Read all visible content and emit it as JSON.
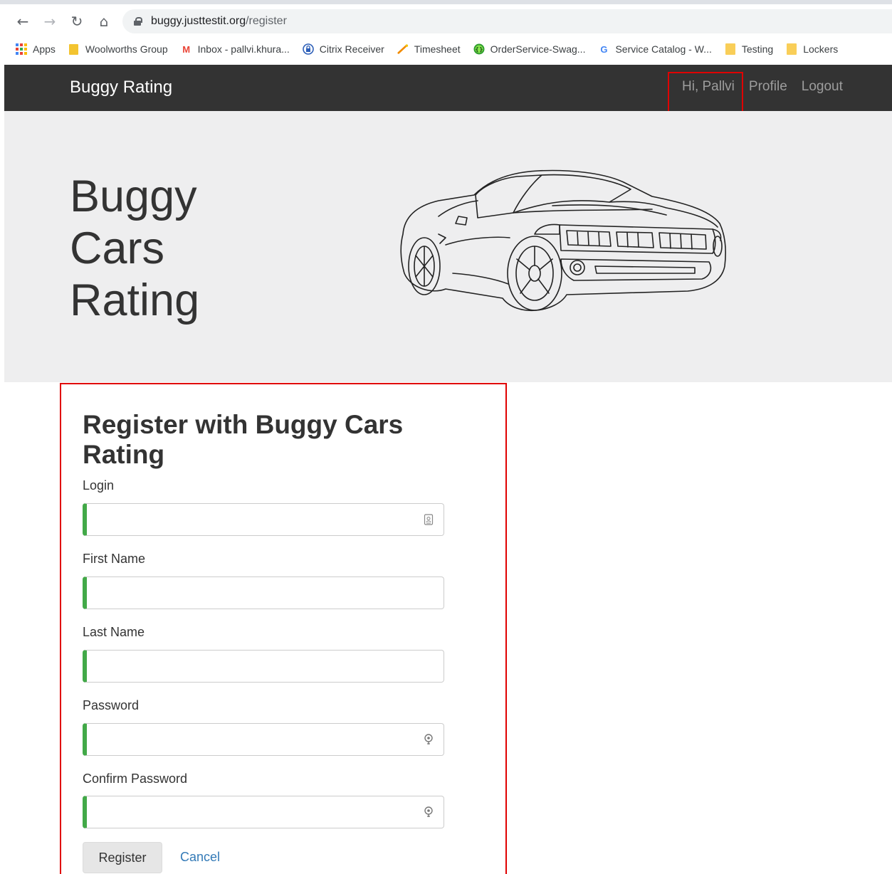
{
  "browser": {
    "url_host": "buggy.justtestit.org",
    "url_path": "/register",
    "bookmarks": [
      {
        "label": "Apps",
        "icon": "apps-grid-icon"
      },
      {
        "label": "Woolworths Group",
        "icon": "woolworths-icon"
      },
      {
        "label": "Inbox - pallvi.khura...",
        "icon": "gmail-icon"
      },
      {
        "label": "Citrix Receiver",
        "icon": "citrix-icon"
      },
      {
        "label": "Timesheet",
        "icon": "timesheet-icon"
      },
      {
        "label": "OrderService-Swag...",
        "icon": "swagger-icon"
      },
      {
        "label": "Service Catalog - W...",
        "icon": "google-icon"
      },
      {
        "label": "Testing",
        "icon": "folder-icon"
      },
      {
        "label": "Lockers",
        "icon": "folder-icon"
      }
    ]
  },
  "navbar": {
    "brand": "Buggy Rating",
    "greeting": "Hi, Pallvi",
    "profile": "Profile",
    "logout": "Logout",
    "bg_color": "#333333"
  },
  "hero": {
    "line1": "Buggy",
    "line2": "Cars",
    "line3": "Rating"
  },
  "form": {
    "title": "Register with Buggy Cars Rating",
    "fields": [
      {
        "label": "Login",
        "value": "",
        "icon": "contact-card-icon"
      },
      {
        "label": "First Name",
        "value": "",
        "icon": ""
      },
      {
        "label": "Last Name",
        "value": "",
        "icon": ""
      },
      {
        "label": "Password",
        "value": "",
        "icon": "password-key-icon"
      },
      {
        "label": "Confirm Password",
        "value": "",
        "icon": "password-key-icon"
      }
    ],
    "register_label": "Register",
    "cancel_label": "Cancel",
    "valid_color": "#42a948",
    "link_color": "#337ab7",
    "annotation_color": "#e00000"
  }
}
